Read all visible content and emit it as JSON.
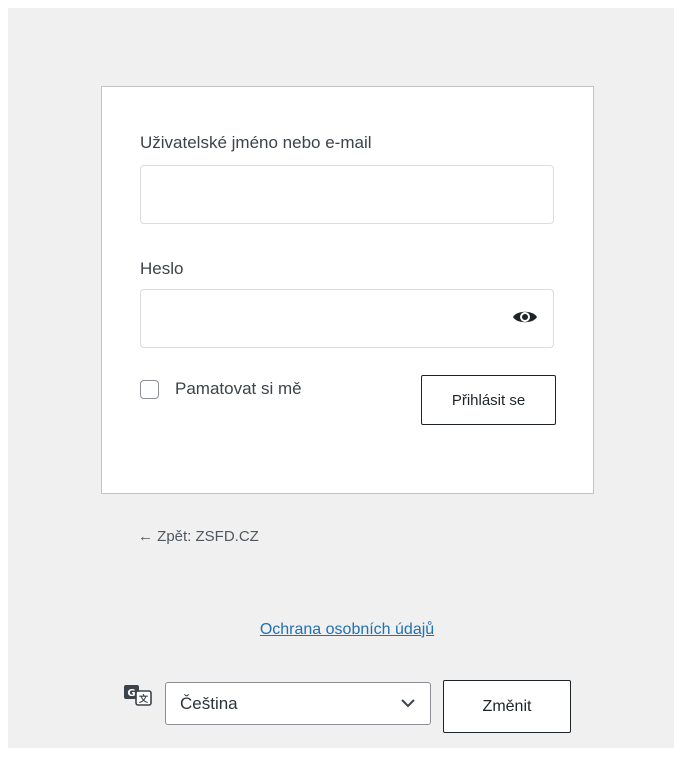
{
  "login": {
    "username_label": "Uživatelské jméno nebo e-mail",
    "username_value": "",
    "password_label": "Heslo",
    "password_value": "",
    "remember_label": "Pamatovat si mě",
    "submit_label": "Přihlásit se",
    "show_password_icon": "eye-icon"
  },
  "back_link": "← Zpět: ZSFD.CZ",
  "privacy_link": "Ochrana osobních údajů",
  "language": {
    "icon": "translate-icon",
    "selected": "Čeština",
    "change_label": "Změnit"
  },
  "colors": {
    "background": "#f0f0f1",
    "link": "#2271b1",
    "text": "#3c434a"
  }
}
